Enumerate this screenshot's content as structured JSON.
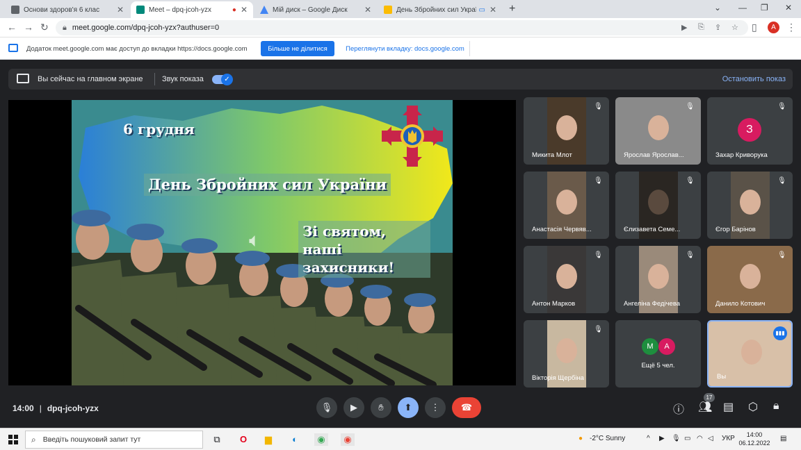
{
  "browser": {
    "tabs": [
      {
        "label": "Основи здоров'я 6 клас",
        "favicon_color": "#5f6368"
      },
      {
        "label": "Meet – dpq-jcoh-yzx",
        "favicon_color": "#00897b",
        "active": true
      },
      {
        "label": "Мій диск – Google Диск",
        "favicon_color": "#4285f4"
      },
      {
        "label": "День Збройних сил України",
        "favicon_color": "#fbbc04"
      }
    ],
    "url": "meet.google.com/dpq-jcoh-yzx?authuser=0",
    "profile_initial": "A"
  },
  "share_bar": {
    "message": "Додаток meet.google.com має доступ до вкладки https://docs.google.com",
    "stop_share_label": "Більше не ділитися",
    "switch_tab_label": "Переглянути вкладку: docs.google.com"
  },
  "presenting_bar": {
    "status": "Вы сейчас на главном экране",
    "sound_label": "Звук показа",
    "stop_label": "Остановить показ"
  },
  "slide": {
    "date": "6 грудня",
    "title": "День Збройних сил України",
    "congrats_line1": "Зі святом, наші",
    "congrats_line2": "захисники!"
  },
  "participants": [
    {
      "name": "Микита Млот",
      "bg": "#4a3a2a"
    },
    {
      "name": "Ярослав Ярослав...",
      "bg": "#8a8a8a"
    },
    {
      "name": "Захар Криворука",
      "initial": "З",
      "avatar_color": "#d81b60"
    },
    {
      "name": "Анастасія Червяв...",
      "bg": "#6a5a4a"
    },
    {
      "name": "Єлизавета Семе...",
      "bg": "#2a2622"
    },
    {
      "name": "Єгор Барінов",
      "bg": "#5a5248"
    },
    {
      "name": "Антон Марков",
      "bg": "#3a3838"
    },
    {
      "name": "Ангеліна Федічева",
      "bg": "#9a8a7a"
    },
    {
      "name": "Данило Котович",
      "bg": "#8a6a4a"
    },
    {
      "name": "Вікторія Щербіна",
      "bg": "#c8b8a0"
    },
    {
      "more_label": "Ещё 5 чел.",
      "avatars": [
        {
          "initial": "М",
          "color": "#1e8e3e"
        },
        {
          "initial": "А",
          "color": "#d81b60"
        }
      ]
    },
    {
      "name": "Вы",
      "bg": "#d8c0a8",
      "self": true
    }
  ],
  "controls": {
    "time": "14:00",
    "meeting_code": "dpq-jcoh-yzx",
    "participants_count": "17"
  },
  "taskbar": {
    "search_placeholder": "Введіть пошуковий запит тут",
    "weather": "-2°C  Sunny",
    "language": "УКР",
    "time": "14:00",
    "date": "06.12.2022"
  },
  "colors": {
    "meet_bg": "#202124",
    "accent_blue": "#1a73e8",
    "end_call_red": "#ea4335"
  }
}
